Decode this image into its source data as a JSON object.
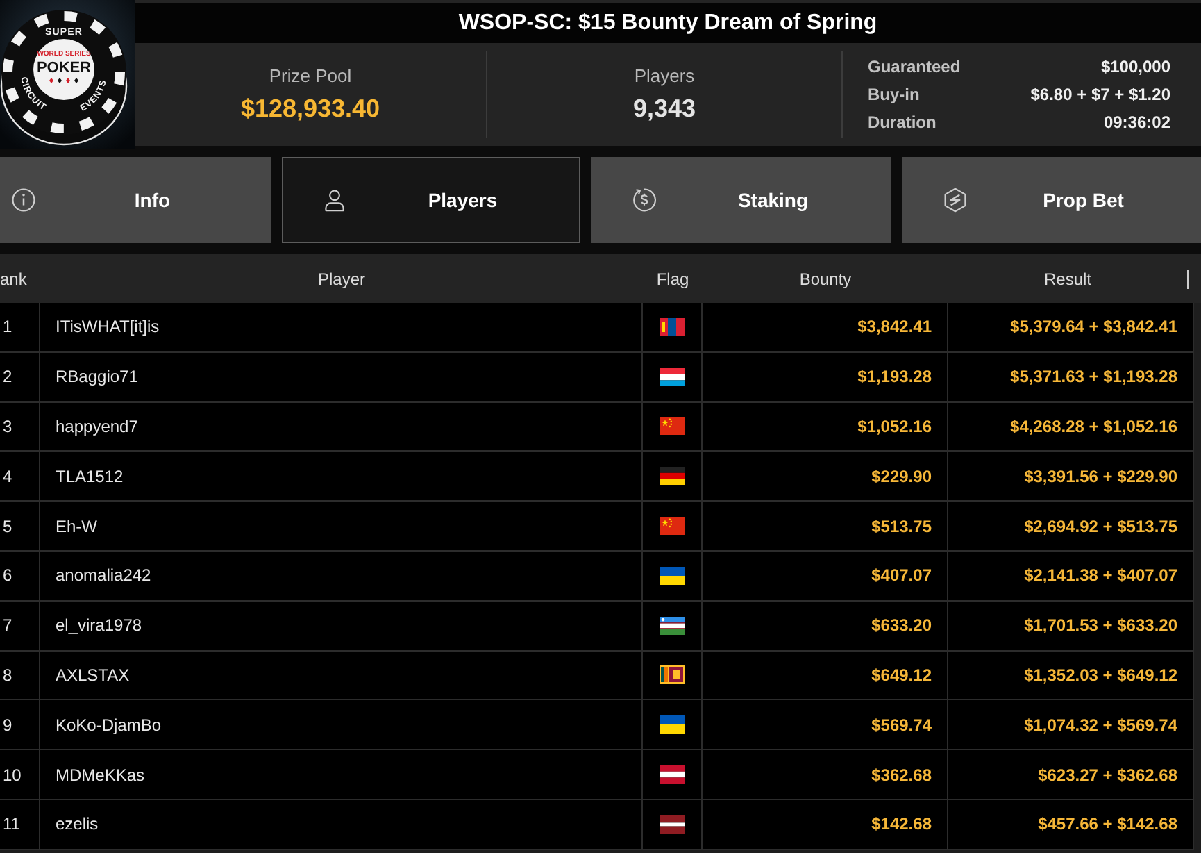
{
  "logo": {
    "top": "SUPER",
    "band": "WORLD SERIES",
    "name": "POKER",
    "left": "CIRCUIT",
    "right": "EVENTS"
  },
  "title": "WSOP-SC: $15 Bounty Dream of Spring",
  "stats": [
    {
      "label": "Prize Pool",
      "value": "$128,933.40",
      "kind": "money"
    },
    {
      "label": "Players",
      "value": "9,343",
      "kind": "count"
    }
  ],
  "details": [
    {
      "label": "Guaranteed",
      "value": "$100,000"
    },
    {
      "label": "Buy-in",
      "value": "$6.80 + $7 + $1.20"
    },
    {
      "label": "Duration",
      "value": "09:36:02"
    }
  ],
  "tabs": [
    {
      "label": "Info",
      "kind": "info",
      "selected": false
    },
    {
      "label": "Players",
      "kind": "players",
      "selected": true
    },
    {
      "label": "Staking",
      "kind": "staking",
      "selected": false
    },
    {
      "label": "Prop Bet",
      "kind": "prop-bet",
      "selected": false
    }
  ],
  "table": {
    "columns": [
      "ank",
      "Player",
      "Flag",
      "Bounty",
      "Result"
    ],
    "rows": [
      {
        "rank": "1",
        "player": "ITisWHAT[it]is",
        "flag": {
          "kind": "mongolia"
        },
        "bounty": "$3,842.41",
        "result": "$5,379.64 + $3,842.41"
      },
      {
        "rank": "2",
        "player": "RBaggio71",
        "flag": {
          "kind": "luxembourg"
        },
        "bounty": "$1,193.28",
        "result": "$5,371.63 + $1,193.28"
      },
      {
        "rank": "3",
        "player": "happyend7",
        "flag": {
          "kind": "china"
        },
        "bounty": "$1,052.16",
        "result": "$4,268.28 + $1,052.16"
      },
      {
        "rank": "4",
        "player": "TLA1512",
        "flag": {
          "kind": "germany"
        },
        "bounty": "$229.90",
        "result": "$3,391.56 + $229.90"
      },
      {
        "rank": "5",
        "player": "Eh-W",
        "flag": {
          "kind": "china"
        },
        "bounty": "$513.75",
        "result": "$2,694.92 + $513.75"
      },
      {
        "rank": "6",
        "player": "anomalia242",
        "flag": {
          "kind": "ukraine"
        },
        "bounty": "$407.07",
        "result": "$2,141.38 + $407.07"
      },
      {
        "rank": "7",
        "player": "el_vira1978",
        "flag": {
          "kind": "uzbekistan"
        },
        "bounty": "$633.20",
        "result": "$1,701.53 + $633.20"
      },
      {
        "rank": "8",
        "player": "AXLSTAX",
        "flag": {
          "kind": "sri-lanka"
        },
        "bounty": "$649.12",
        "result": "$1,352.03 + $649.12"
      },
      {
        "rank": "9",
        "player": "KoKo-DjamBo",
        "flag": {
          "kind": "ukraine"
        },
        "bounty": "$569.74",
        "result": "$1,074.32 + $569.74"
      },
      {
        "rank": "10",
        "player": "MDMeKKas",
        "flag": {
          "kind": "austria"
        },
        "bounty": "$362.68",
        "result": "$623.27 + $362.68"
      },
      {
        "rank": "11",
        "player": "ezelis",
        "flag": {
          "kind": "latvia"
        },
        "bounty": "$142.68",
        "result": "$457.66 + $142.68"
      }
    ]
  }
}
